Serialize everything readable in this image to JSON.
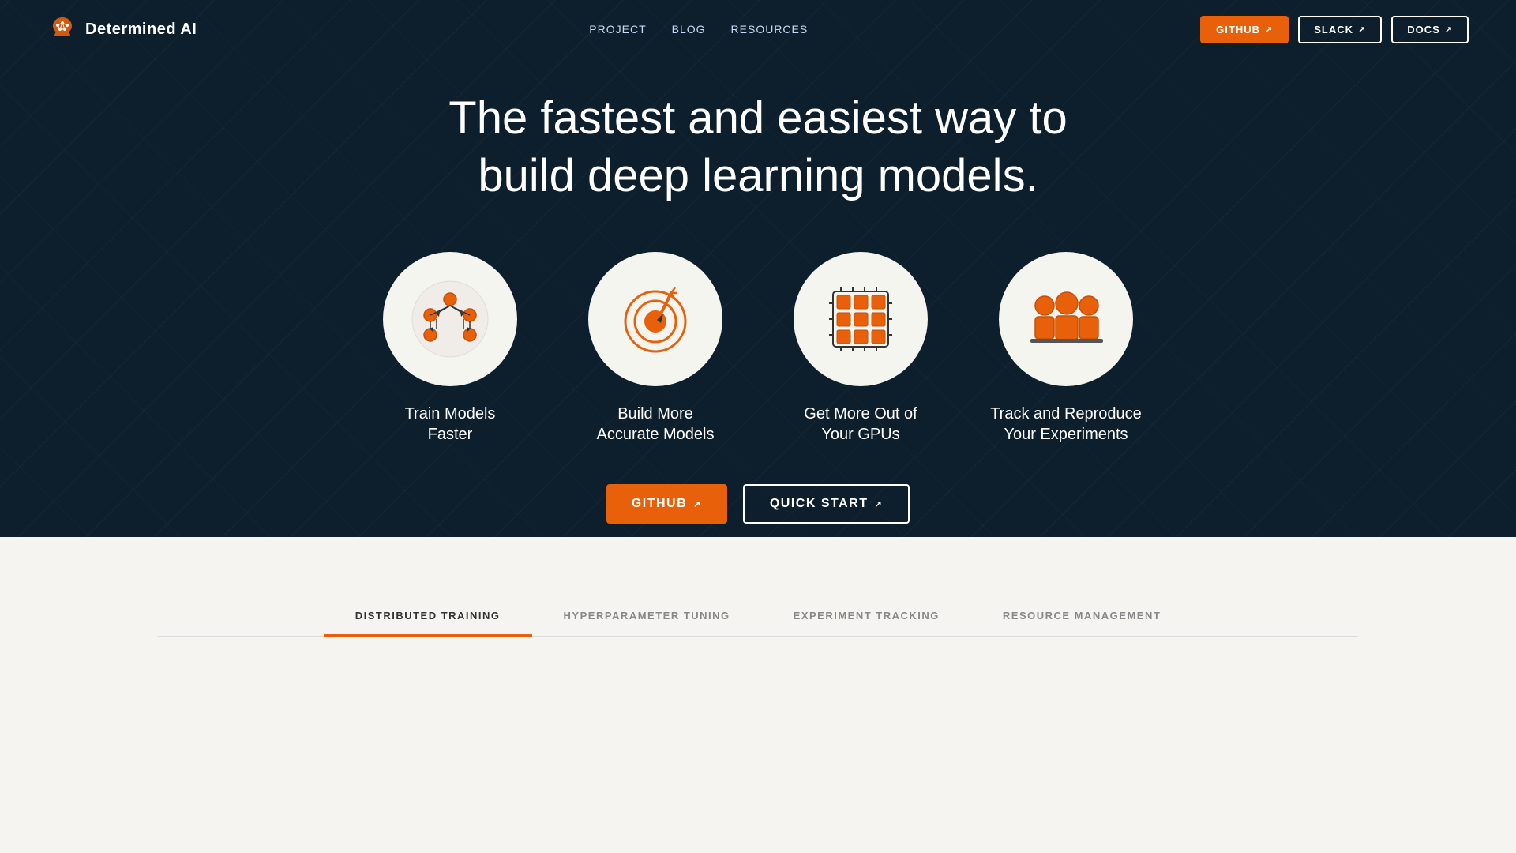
{
  "brand": {
    "name": "Determined AI",
    "logo_alt": "Determined AI Logo"
  },
  "nav": {
    "links": [
      {
        "id": "project",
        "label": "PROJECT"
      },
      {
        "id": "blog",
        "label": "BLOG"
      },
      {
        "id": "resources",
        "label": "RESOURCES"
      }
    ],
    "buttons": [
      {
        "id": "github",
        "label": "GITHUB",
        "style": "orange",
        "external": true
      },
      {
        "id": "slack",
        "label": "SLACK",
        "style": "outline",
        "external": true
      },
      {
        "id": "docs",
        "label": "DOCS",
        "style": "outline",
        "external": true
      }
    ]
  },
  "hero": {
    "title_line1": "The fastest and easiest way to",
    "title_line2": "build deep learning models."
  },
  "features": [
    {
      "id": "train-models",
      "label_line1": "Train Models",
      "label_line2": "Faster",
      "icon": "distributed"
    },
    {
      "id": "accurate-models",
      "label_line1": "Build More",
      "label_line2": "Accurate Models",
      "icon": "target"
    },
    {
      "id": "gpu",
      "label_line1": "Get More Out of",
      "label_line2": "Your GPUs",
      "icon": "gpu"
    },
    {
      "id": "track",
      "label_line1": "Track and Reproduce",
      "label_line2": "Your Experiments",
      "icon": "team"
    }
  ],
  "cta": {
    "github_label": "GITHUB",
    "quickstart_label": "QUICK START"
  },
  "tabs": [
    {
      "id": "distributed",
      "label": "DISTRIBUTED TRAINING",
      "active": true
    },
    {
      "id": "hyperparameter",
      "label": "HYPERPARAMETER TUNING",
      "active": false
    },
    {
      "id": "experiment",
      "label": "EXPERIMENT TRACKING",
      "active": false
    },
    {
      "id": "resource",
      "label": "RESOURCE MANAGEMENT",
      "active": false
    }
  ],
  "colors": {
    "orange": "#e8610a",
    "hero_bg": "#0d1f2d",
    "tabs_bg": "#f5f4f0"
  }
}
